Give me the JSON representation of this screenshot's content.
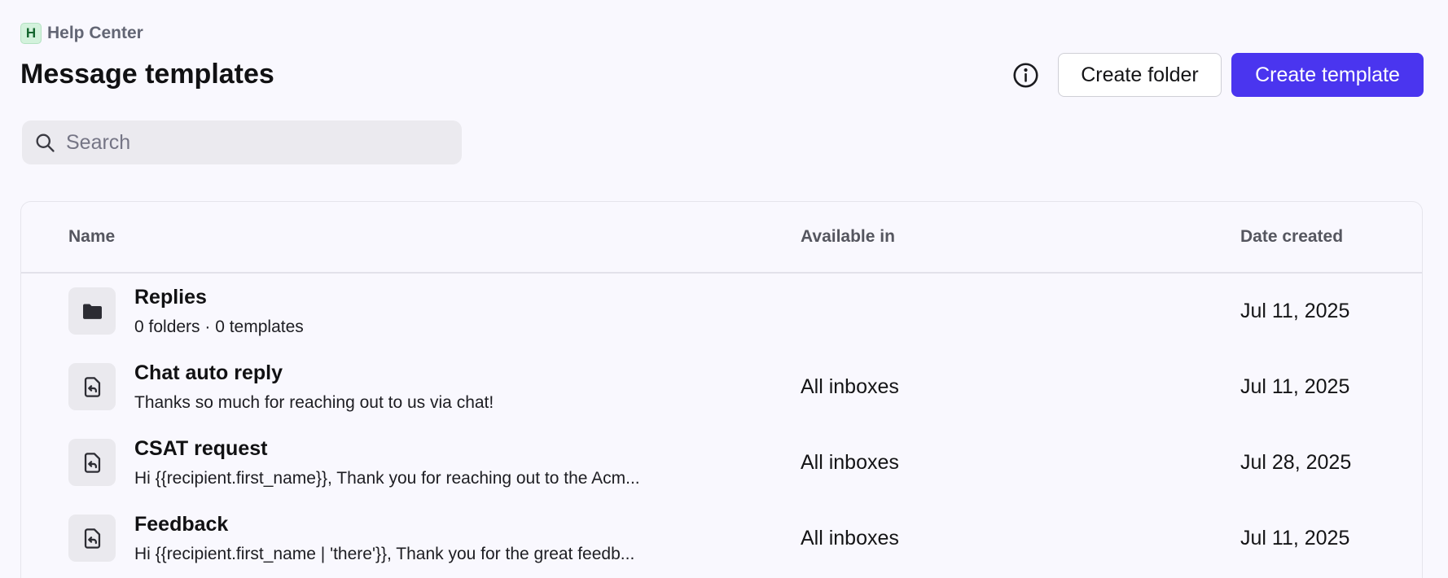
{
  "breadcrumb": {
    "badge_letter": "H",
    "workspace_name": "Help Center"
  },
  "header": {
    "title": "Message templates",
    "info_icon": "info-circle-icon",
    "create_folder_label": "Create folder",
    "create_template_label": "Create template"
  },
  "search": {
    "placeholder": "Search",
    "value": "",
    "icon": "search-icon"
  },
  "table": {
    "columns": {
      "name": "Name",
      "available_in": "Available in",
      "date_created": "Date created"
    },
    "rows": [
      {
        "icon": "folder-icon",
        "title": "Replies",
        "subtitle": "0 folders · 0 templates",
        "available_in": "",
        "date_created": "Jul 11, 2025"
      },
      {
        "icon": "reply-template-icon",
        "title": "Chat auto reply",
        "subtitle": "Thanks so much for reaching out to us via chat!",
        "available_in": "All inboxes",
        "date_created": "Jul 11, 2025"
      },
      {
        "icon": "reply-template-icon",
        "title": "CSAT request",
        "subtitle": "Hi {{recipient.first_name}}, Thank you for reaching out to the Acm...",
        "available_in": "All inboxes",
        "date_created": "Jul 28, 2025"
      },
      {
        "icon": "reply-template-icon",
        "title": "Feedback",
        "subtitle": "Hi {{recipient.first_name | 'there'}}, Thank you for the great feedb...",
        "available_in": "All inboxes",
        "date_created": "Jul 11, 2025"
      }
    ]
  },
  "colors": {
    "background": "#f9f8fe",
    "primary_button": "#4a35ef",
    "workspace_badge_bg": "#d3f2dc",
    "workspace_badge_text": "#15662f",
    "search_bg": "#ebeaef",
    "icon_tile_bg": "#eae9ee"
  }
}
